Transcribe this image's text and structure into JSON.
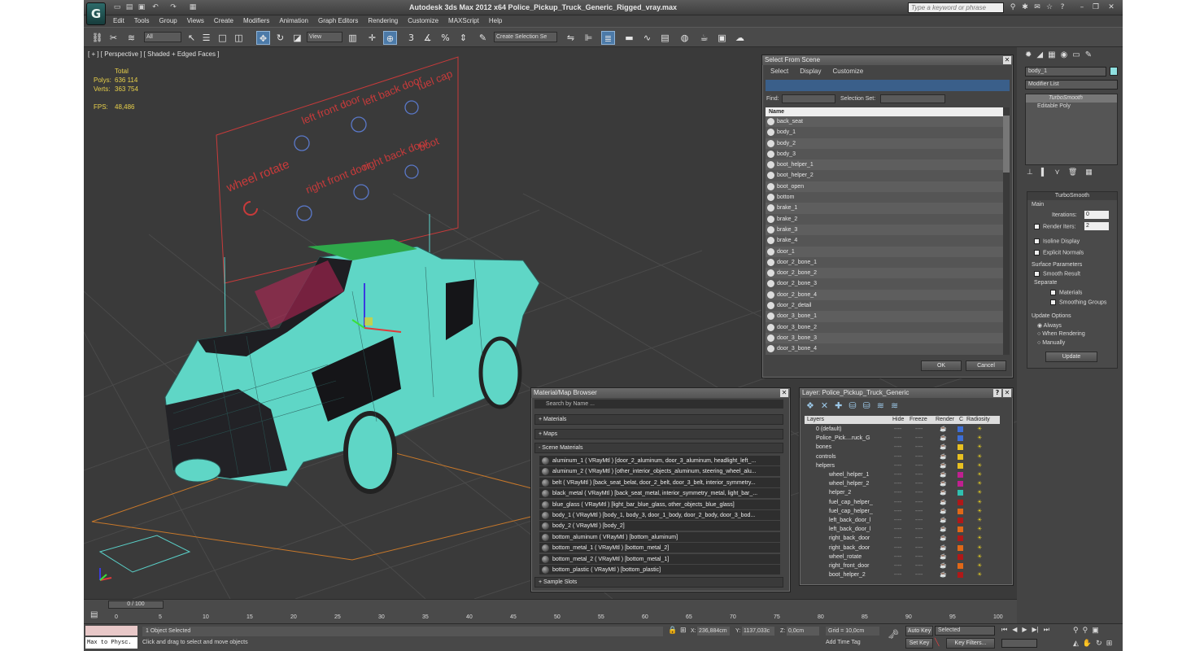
{
  "app": {
    "title": "Autodesk 3ds Max  2012 x64     Police_Pickup_Truck_Generic_Rigged_vray.max",
    "logo": "G",
    "search_placeholder": "Type a keyword or phrase"
  },
  "menu": [
    "Edit",
    "Tools",
    "Group",
    "Views",
    "Create",
    "Modifiers",
    "Animation",
    "Graph Editors",
    "Rendering",
    "Customize",
    "MAXScript",
    "Help"
  ],
  "toolbar": {
    "filter": "All",
    "refcoord": "View",
    "selection_set": "Create Selection Se",
    "snap_labels": [
      "3",
      "%",
      "n"
    ]
  },
  "viewport": {
    "label": "[ + ] [ Perspective ] [ Shaded + Edged Faces ]",
    "stats": {
      "header": "Total",
      "polys_label": "Polys:",
      "polys": "636 114",
      "verts_label": "Verts:",
      "verts": "363 754",
      "fps_label": "FPS:",
      "fps": "48,486"
    },
    "rig_labels": [
      "left front door",
      "left back door",
      "fuel cap",
      "wheel rotate",
      "right front door",
      "right back door",
      "boot"
    ]
  },
  "select_from_scene": {
    "title": "Select From Scene",
    "menus": [
      "Select",
      "Display",
      "Customize"
    ],
    "find_label": "Find:",
    "selection_set_label": "Selection Set:",
    "column": "Name",
    "items": [
      "back_seat",
      "body_1",
      "body_2",
      "body_3",
      "boot_helper_1",
      "boot_helper_2",
      "boot_open",
      "bottom",
      "brake_1",
      "brake_2",
      "brake_3",
      "brake_4",
      "door_1",
      "door_2_bone_1",
      "door_2_bone_2",
      "door_2_bone_3",
      "door_2_bone_4",
      "door_2_detail",
      "door_3_bone_1",
      "door_3_bone_2",
      "door_3_bone_3",
      "door_3_bone_4"
    ],
    "ok": "OK",
    "cancel": "Cancel"
  },
  "material_browser": {
    "title": "Material/Map Browser",
    "search_placeholder": "Search by Name ...",
    "sections": [
      "+ Materials",
      "+ Maps",
      "- Scene Materials",
      "+ Sample Slots"
    ],
    "materials": [
      "aluminum_1  ( VRayMtl )  [door_2_aluminum, door_3_aluminum, headlight_left_...",
      "aluminum_2  ( VRayMtl )  [other_interior_objects_aluminum, steering_wheel_alu...",
      "belt  ( VRayMtl )  [back_seat_belat, door_2_belt, door_3_belt, interior_symmetry...",
      "black_metal  ( VRayMtl )  [back_seat_metal, interior_symmetry_metal, light_bar_...",
      "blue_glass  ( VRayMtl )  [light_bar_blue_glass, other_objects_blue_glass]",
      "body_1  ( VRayMtl )  [body_1, body_3, door_1_body, door_2_body, door_3_bod...",
      "body_2  ( VRayMtl )  [body_2]",
      "bottom_aluminum  ( VRayMtl )  [bottom_aluminum]",
      "bottom_metal_1  ( VRayMtl )  [bottom_metal_2]",
      "bottom_metal_2  ( VRayMtl )  [bottom_metal_1]",
      "bottom_plastic  ( VRayMtl )  [bottom_plastic]"
    ]
  },
  "layer_panel": {
    "title": "Layer: Police_Pickup_Truck_Generic",
    "headers": [
      "Layers",
      "Hide",
      "Freeze",
      "Render",
      "C",
      "Radiosity"
    ],
    "layers": [
      {
        "name": "0 (default)",
        "color": "#3d6ed6"
      },
      {
        "name": "Police_Pick....ruck_G",
        "color": "#3d6ed6"
      },
      {
        "name": "bones",
        "color": "#e8c020"
      },
      {
        "name": "controls",
        "color": "#e8c020"
      },
      {
        "name": "helpers",
        "color": "#e8c020"
      },
      {
        "name": "wheel_helper_1",
        "color": "#c02090"
      },
      {
        "name": "wheel_helper_2",
        "color": "#c02090"
      },
      {
        "name": "helper_2",
        "color": "#30c0b0"
      },
      {
        "name": "fuel_cap_helper_",
        "color": "#b01818"
      },
      {
        "name": "fuel_cap_helper_",
        "color": "#e06818"
      },
      {
        "name": "left_back_door_l",
        "color": "#b01818"
      },
      {
        "name": "left_back_door_l",
        "color": "#e06818"
      },
      {
        "name": "right_back_door",
        "color": "#b01818"
      },
      {
        "name": "right_back_door",
        "color": "#e06818"
      },
      {
        "name": "wheel_rotate",
        "color": "#b01818"
      },
      {
        "name": "right_front_door",
        "color": "#e06818"
      },
      {
        "name": "boot_helper_2",
        "color": "#b01818"
      }
    ]
  },
  "command_panel": {
    "object_name": "body_1",
    "modifier_list": "Modifier List",
    "stack": [
      "TurboSmooth",
      "Editable Poly"
    ],
    "rollout_title": "TurboSmooth",
    "main": "Main",
    "iterations_label": "Iterations:",
    "iterations": "0",
    "render_iters_label": "Render Iters:",
    "render_iters": "2",
    "isoline": "Isoline Display",
    "explicit": "Explicit Normals",
    "surface_params": "Surface Parameters",
    "smooth_result": "Smooth Result",
    "separate": "Separate",
    "materials": "Materials",
    "smoothing_groups": "Smoothing Groups",
    "update_options": "Update Options",
    "always": "Always",
    "when_rendering": "When Rendering",
    "manually": "Manually",
    "update": "Update"
  },
  "timeline": {
    "frame": "0 / 100",
    "ticks": [
      "0",
      "5",
      "10",
      "15",
      "20",
      "25",
      "30",
      "35",
      "40",
      "45",
      "50",
      "55",
      "60",
      "65",
      "70",
      "75",
      "80",
      "85",
      "90",
      "95",
      "100"
    ]
  },
  "status": {
    "selected": "1 Object Selected",
    "prompt": "Click and drag to select and move objects",
    "maxscript": "Max to Physc.",
    "x_label": "X:",
    "x": "236,884cm",
    "y_label": "Y:",
    "y": "1137,033c",
    "z_label": "Z:",
    "z": "0,0cm",
    "grid": "Grid = 10,0cm",
    "add_time_tag": "Add Time Tag",
    "auto_key": "Auto Key",
    "set_key": "Set Key",
    "selected_dd": "Selected",
    "key_filters": "Key Filters..."
  }
}
